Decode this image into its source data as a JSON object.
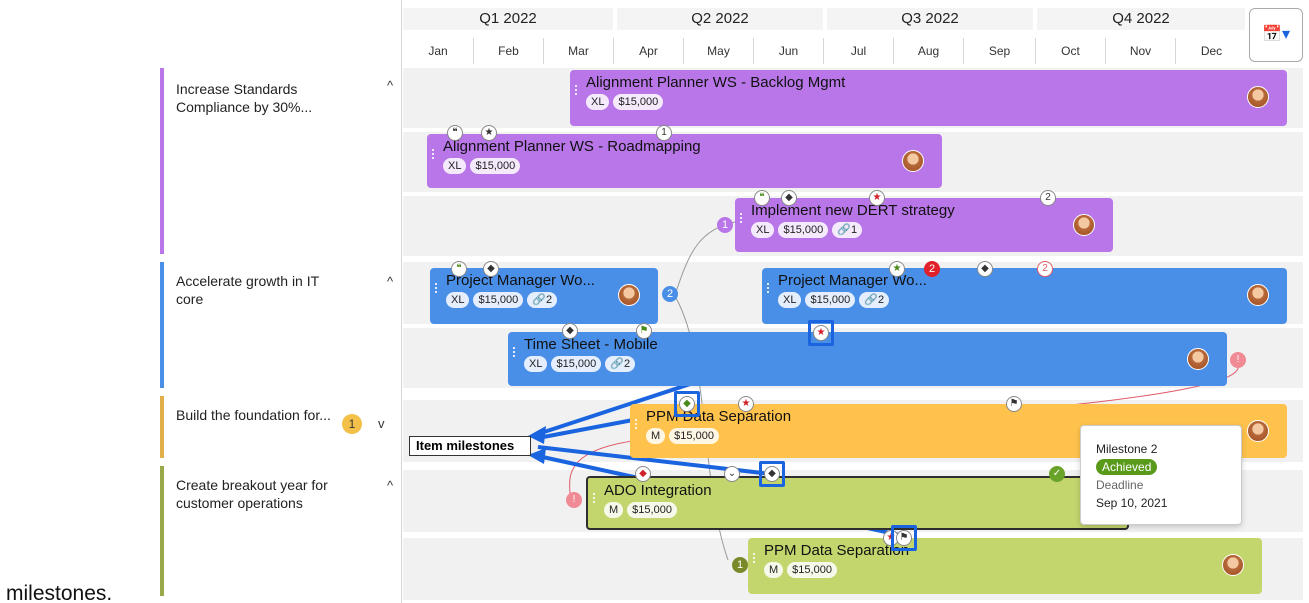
{
  "quarters": [
    "Q1 2022",
    "Q2 2022",
    "Q3 2022",
    "Q4 2022"
  ],
  "months": [
    "Jan",
    "Feb",
    "Mar",
    "Apr",
    "May",
    "Jun",
    "Jul",
    "Aug",
    "Sep",
    "Oct",
    "Nov",
    "Dec"
  ],
  "calendar_icon": "calendar-icon",
  "goals": [
    {
      "title": "Increase Standards Compliance by 30%...",
      "color": "#b876e8",
      "caret": "^"
    },
    {
      "title": "Accelerate growth in IT core",
      "color": "#4a8fe7",
      "caret": "^"
    },
    {
      "title": "Build the foundation for...",
      "color": "#e2b04a",
      "caret": "v",
      "count": "1"
    },
    {
      "title": "Create breakout year for customer operations",
      "color": "#9aa84a",
      "caret": "^"
    }
  ],
  "bars": {
    "b1": {
      "title": "Alignment Planner WS - Backlog Mgmt",
      "size": "XL",
      "cost": "$15,000"
    },
    "b2": {
      "title": "Alignment Planner WS - Roadmapping",
      "size": "XL",
      "cost": "$15,000"
    },
    "b3": {
      "title": "Implement new DERT strategy",
      "size": "XL",
      "cost": "$15,000",
      "links": "1"
    },
    "b4": {
      "title": "Project Manager Wo...",
      "size": "XL",
      "cost": "$15,000",
      "links": "2"
    },
    "b5": {
      "title": "Project Manager Wo...",
      "size": "XL",
      "cost": "$15,000",
      "links": "2"
    },
    "b6": {
      "title": "Time Sheet - Mobile",
      "size": "XL",
      "cost": "$15,000",
      "links": "2"
    },
    "b7": {
      "title": "PPM Data Separation",
      "size": "M",
      "cost": "$15,000"
    },
    "b8": {
      "title": "ADO Integration",
      "size": "M",
      "cost": "$15,000"
    },
    "b9": {
      "title": "PPM Data Separation",
      "size": "M",
      "cost": "$15,000"
    }
  },
  "dependency_counts": {
    "d1": "1",
    "d2": "2",
    "d3": "2",
    "d4": "2",
    "d5": "2",
    "d6": "1"
  },
  "callout": "Item milestones",
  "tooltip": {
    "title": "Milestone 2",
    "status": "Achieved",
    "label": "Deadline",
    "date": "Sep 10, 2021"
  },
  "footnote": "milestones.",
  "colors": {
    "purple": "#b876e8",
    "blue": "#4a8fe7",
    "orange": "#ffc34d",
    "green": "#c3d66e",
    "highlight": "#1a64e0"
  }
}
